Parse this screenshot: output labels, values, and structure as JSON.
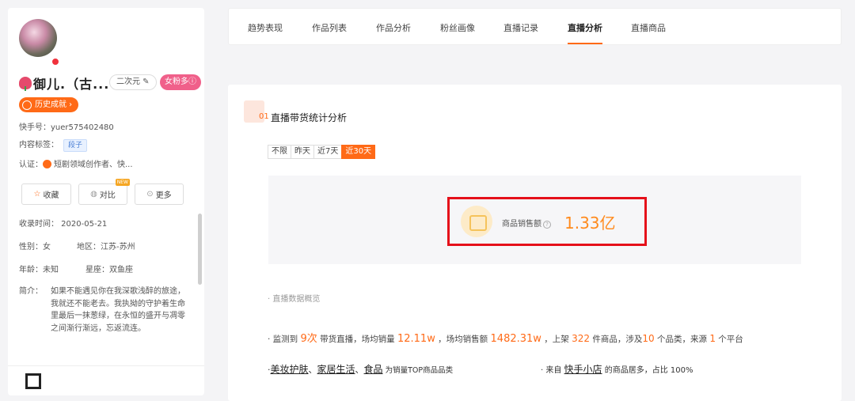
{
  "profile": {
    "name": "御儿.（古...",
    "tag_category": "二次元 ✎",
    "tag_fans": "女粉多ⓘ",
    "history_btn": "历史成就 ›",
    "kuaishou_id": "快手号：yuer575402480",
    "content_tag_label": "内容标签：",
    "content_tag": "段子",
    "cert_label": "认证：",
    "cert_text": "短剧领域创作者、快...",
    "collect_btn": "收藏",
    "compare_btn": "对比",
    "compare_badge": "NEW",
    "more_btn": "更多",
    "recorded": "收录时间：  2020-05-21",
    "gender": "性别：女",
    "region": "地区：江苏-苏州",
    "age": "年龄：未知",
    "constellation": "星座：双鱼座",
    "intro_label": "简介：",
    "intro_text": "如果不能遇见你在我深歌浅醉的旅途，我就还不能老去。我执拗的守护着生命里最后一抹葱绿，在永恒的盛开与凋零之间渐行渐远，忘返流连。"
  },
  "tabs": [
    "趋势表现",
    "作品列表",
    "作品分析",
    "粉丝画像",
    "直播记录",
    "直播分析",
    "直播商品"
  ],
  "active_tab": "直播分析",
  "section": {
    "num": "01",
    "title": "直播带货统计分析",
    "ranges": [
      "不限",
      "昨天",
      "近7天",
      "近30天"
    ],
    "active_range": "近30天",
    "stat_label": "商品销售额",
    "stat_value": "1.33亿",
    "overview_title": "· 直播数据概览",
    "line1": {
      "a": "· 监测到 ",
      "v1": "9次",
      "b": " 带货直播，场均销量 ",
      "v2": "12.11w",
      "c": " ，场均销售额 ",
      "v3": "1482.31w",
      "d": " ，上架 ",
      "v4": "322",
      "e": " 件商品，涉及",
      "v5": "10",
      "f": " 个品类，来源 ",
      "v6": "1",
      "g": " 个平台"
    },
    "line2": {
      "dot": "·",
      "c1": "美妆护肤",
      "sep1": "、",
      "c2": "家居生活",
      "sep2": "、",
      "c3": "食品",
      "suffix": " 为销量TOP商品品类"
    },
    "line3": {
      "a": "· 来自 ",
      "src": "快手小店",
      "b": " 的商品居多，占比 100%"
    }
  },
  "colors": {
    "accent": "#ff6a17",
    "highlight_box": "#e5101a",
    "pink": "#f0608a"
  }
}
